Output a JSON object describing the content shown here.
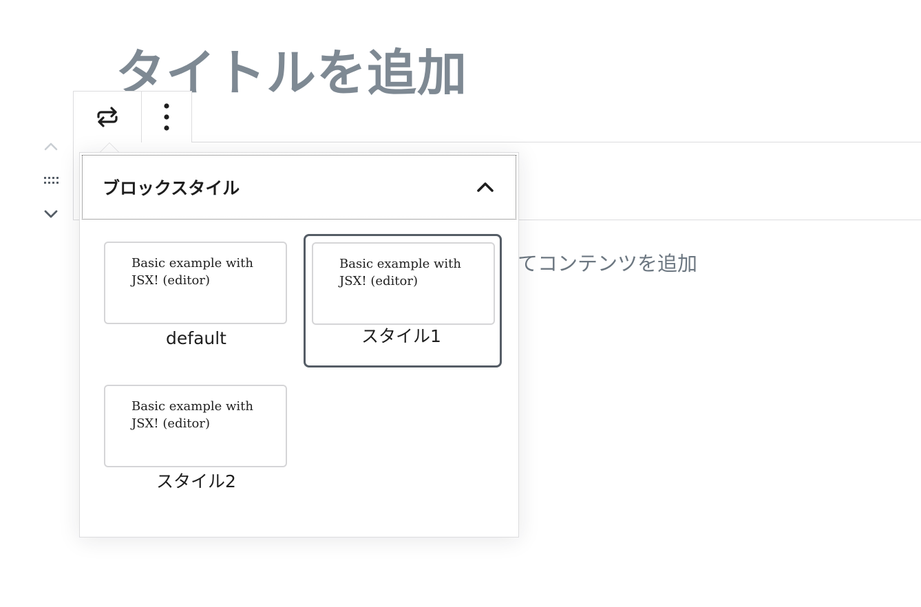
{
  "editor": {
    "title_placeholder": "タイトルを追加",
    "content_placeholder_visible": "てコンテンツを追加"
  },
  "toolbar": {
    "transform_icon": "transform-arrows-icon",
    "more_icon": "more-vertical-icon"
  },
  "mover": {
    "up_icon": "chevron-up-icon",
    "drag_icon": "drag-handle-icon",
    "down_icon": "chevron-down-icon"
  },
  "block_styles": {
    "heading": "ブロックスタイル",
    "collapse_icon": "chevron-up-icon",
    "items": [
      {
        "preview_text": "Basic example with JSX! (editor)",
        "label": "default",
        "active": false
      },
      {
        "preview_text": "Basic example with JSX! (editor)",
        "label": "スタイル1",
        "active": true
      },
      {
        "preview_text": "Basic example with JSX! (editor)",
        "label": "スタイル2",
        "active": false
      }
    ]
  },
  "colors": {
    "title_placeholder": "#7e8993",
    "active_border": "#555d66",
    "border": "#dcdcde"
  }
}
